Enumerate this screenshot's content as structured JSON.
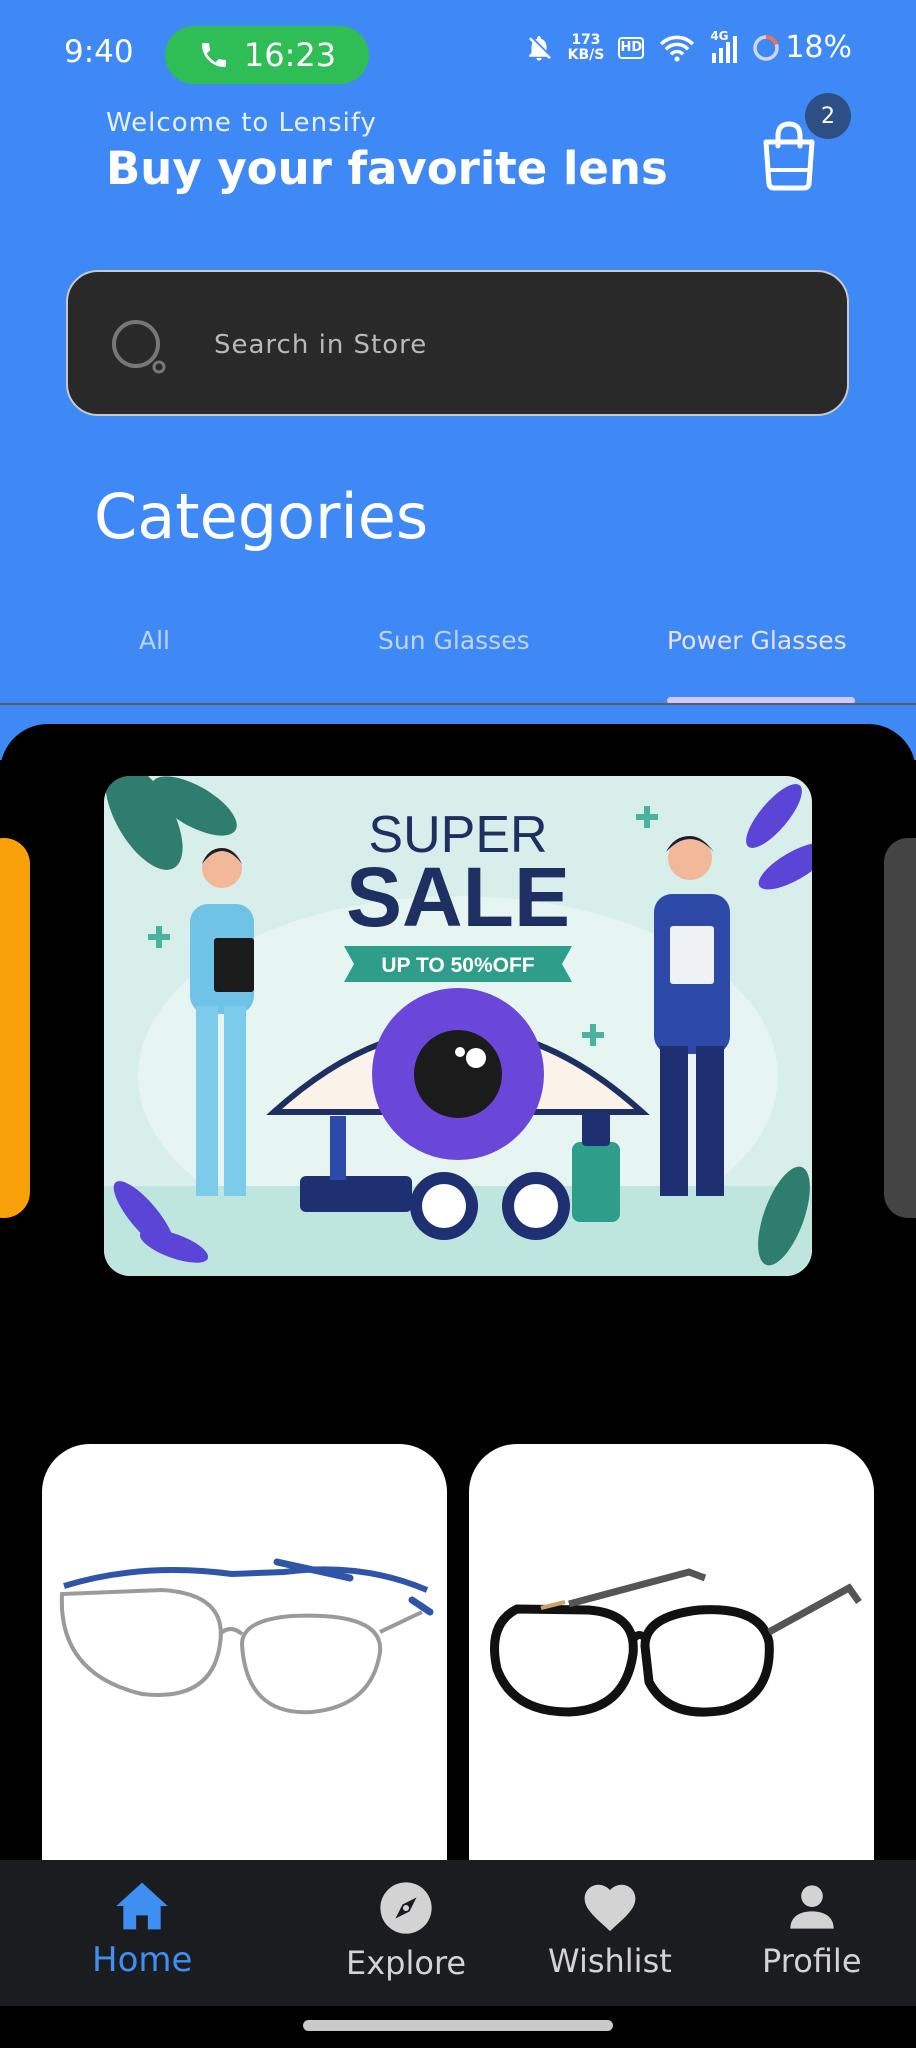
{
  "status_bar": {
    "time": "9:40",
    "call_timer": "16:23",
    "net_speed_value": "173",
    "net_speed_unit": "KB/S",
    "hd_label": "HD",
    "signal_label": "4G",
    "battery": "18%"
  },
  "header": {
    "welcome": "Welcome to Lensify",
    "headline": "Buy your favorite lens",
    "cart_count": "2"
  },
  "search": {
    "placeholder": "Search in Store"
  },
  "categories": {
    "title": "Categories",
    "tabs": [
      {
        "label": "All"
      },
      {
        "label": "Sun Glasses"
      },
      {
        "label": "Power Glasses",
        "selected": true
      }
    ]
  },
  "banner": {
    "line1": "SUPER",
    "line2": "SALE",
    "ribbon": "UP TO 50%OFF"
  },
  "products": [
    {
      "image": "aviator-metal-glasses"
    },
    {
      "image": "black-cat-eye-glasses"
    }
  ],
  "bottom_nav": {
    "items": [
      {
        "label": "Home",
        "icon": "home-icon",
        "active": true
      },
      {
        "label": "Explore",
        "icon": "compass-icon"
      },
      {
        "label": "Wishlist",
        "icon": "heart-icon"
      },
      {
        "label": "Profile",
        "icon": "person-icon"
      }
    ]
  },
  "colors": {
    "header_blue": "#3f89f6",
    "call_green": "#2fbd55",
    "active_nav": "#3f8ff3",
    "tab_indicator": "#d1c8ff"
  }
}
